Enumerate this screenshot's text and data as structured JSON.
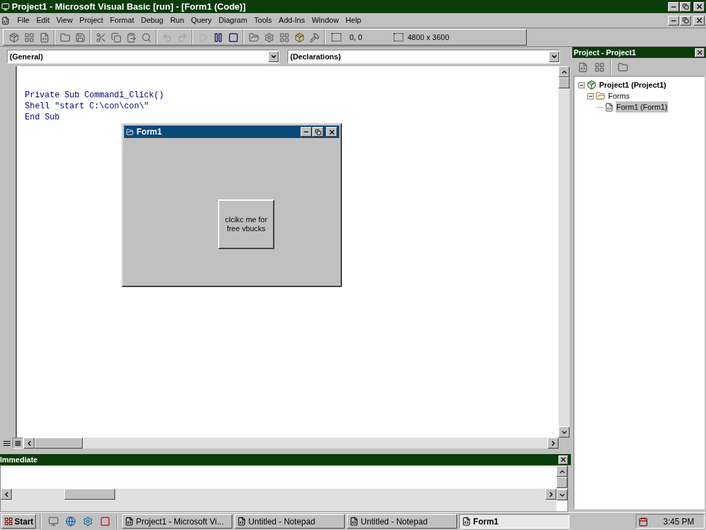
{
  "window": {
    "title": "Project1 - Microsoft Visual Basic [run] - [Form1 (Code)]"
  },
  "menu": [
    "File",
    "Edit",
    "View",
    "Project",
    "Format",
    "Debug",
    "Run",
    "Query",
    "Diagram",
    "Tools",
    "Add-Ins",
    "Window",
    "Help"
  ],
  "toolbar": {
    "position": "0, 0",
    "size": "4800 x 3600"
  },
  "code_window": {
    "object_dropdown": "(General)",
    "procedure_dropdown": "(Declarations)",
    "lines": [
      "Private Sub Command1_Click()",
      "Shell \"start C:\\con\\con\\\"",
      "End Sub"
    ]
  },
  "form_window": {
    "title": "Form1",
    "button": "clcikc me for free vbucks"
  },
  "project_panel": {
    "title": "Project - Project1",
    "tree": [
      {
        "label": "Project1 (Project1)",
        "kind": "project",
        "expanded": true,
        "selected": false,
        "children": [
          {
            "label": "Forms",
            "kind": "folder",
            "expanded": true,
            "selected": false,
            "children": [
              {
                "label": "Form1 (Form1)",
                "kind": "form",
                "selected": true
              }
            ]
          }
        ]
      }
    ]
  },
  "immediate": {
    "title": "Immediate"
  },
  "taskbar": {
    "start": "Start",
    "tasks": [
      {
        "label": "Project1 - Microsoft Vi...",
        "selected": false
      },
      {
        "label": "Untitled - Notepad",
        "selected": false
      },
      {
        "label": "Untitled - Notepad",
        "selected": false
      },
      {
        "label": "Form1",
        "selected": true
      }
    ],
    "clock": "3:45 PM"
  }
}
